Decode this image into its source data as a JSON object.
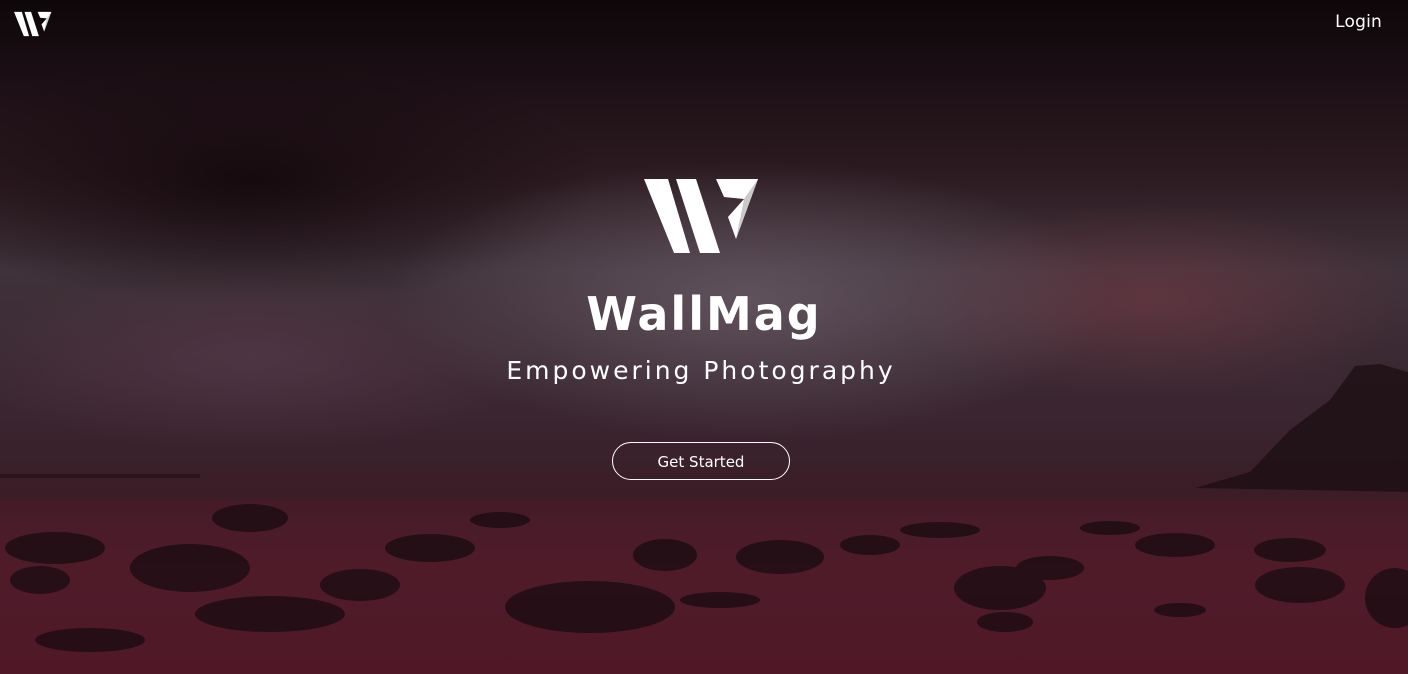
{
  "nav": {
    "logo_icon": "wallmag-logo-icon",
    "login_label": "Login"
  },
  "hero": {
    "logo_icon": "wallmag-logo-icon",
    "title": "WallMag",
    "tagline": "Empowering Photography",
    "cta_label": "Get Started",
    "background": "long-exposure-seascape-photo"
  },
  "colors": {
    "text": "#ffffff",
    "button_border": "#ffffff",
    "overlay_dark": "#140a0e",
    "overlay_tint": "#4c1826"
  }
}
